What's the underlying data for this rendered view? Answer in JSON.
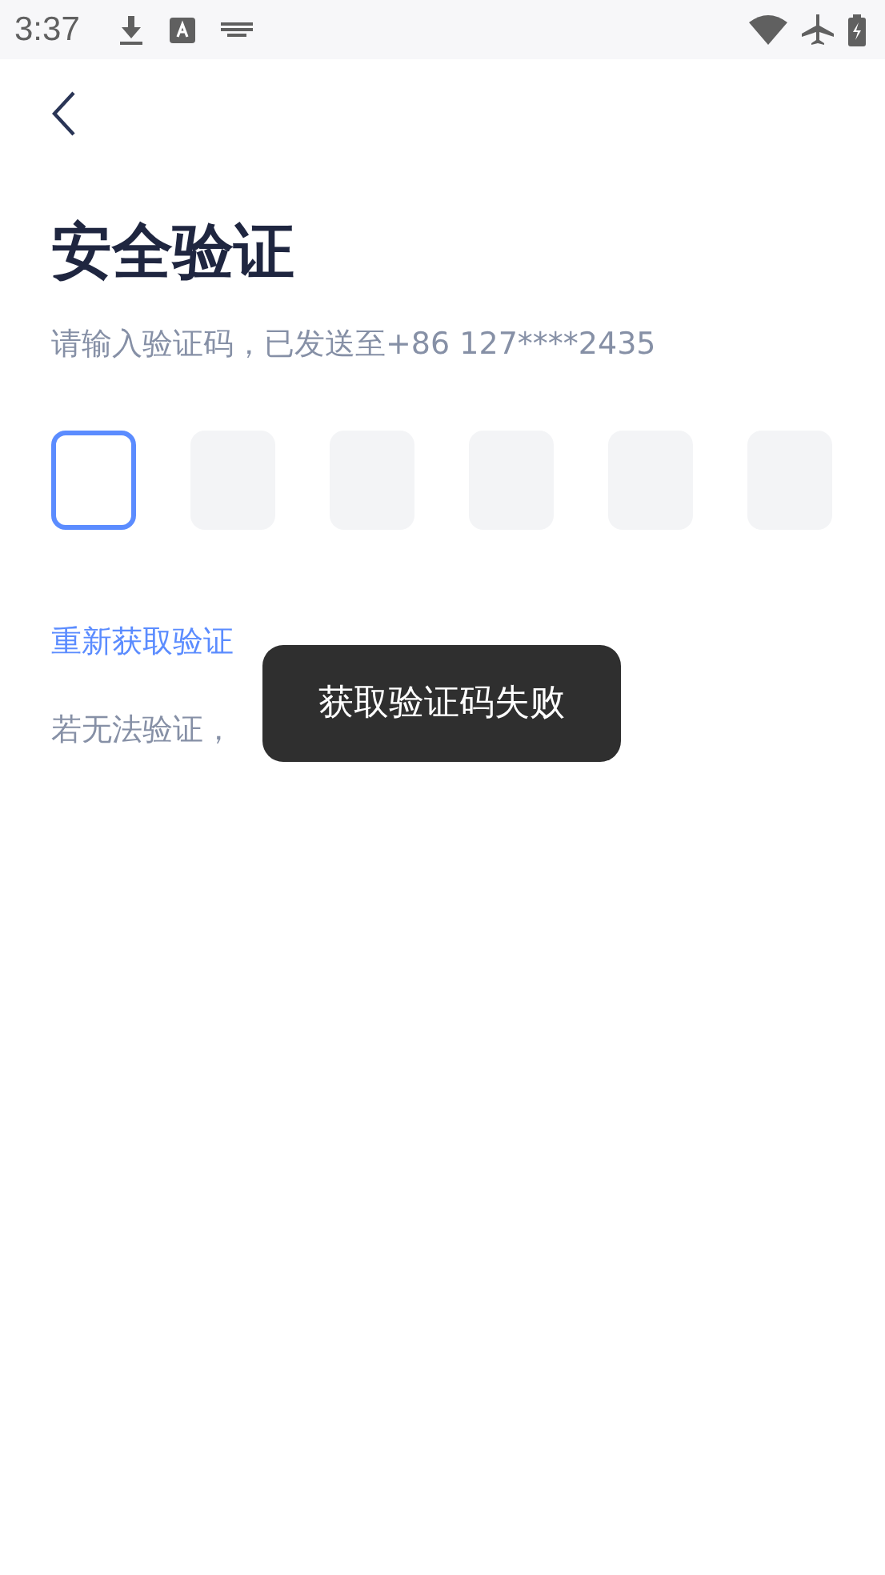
{
  "status_bar": {
    "time": "3:37"
  },
  "title": "安全验证",
  "subtitle": "请输入验证码，已发送至+86 127****2435",
  "code_boxes": [
    {
      "focused": true
    },
    {
      "focused": false
    },
    {
      "focused": false
    },
    {
      "focused": false
    },
    {
      "focused": false
    },
    {
      "focused": false
    }
  ],
  "resend_link": "重新获取验证",
  "appeal": {
    "text": "若无法验证，"
  },
  "toast": "获取验证码失败"
}
